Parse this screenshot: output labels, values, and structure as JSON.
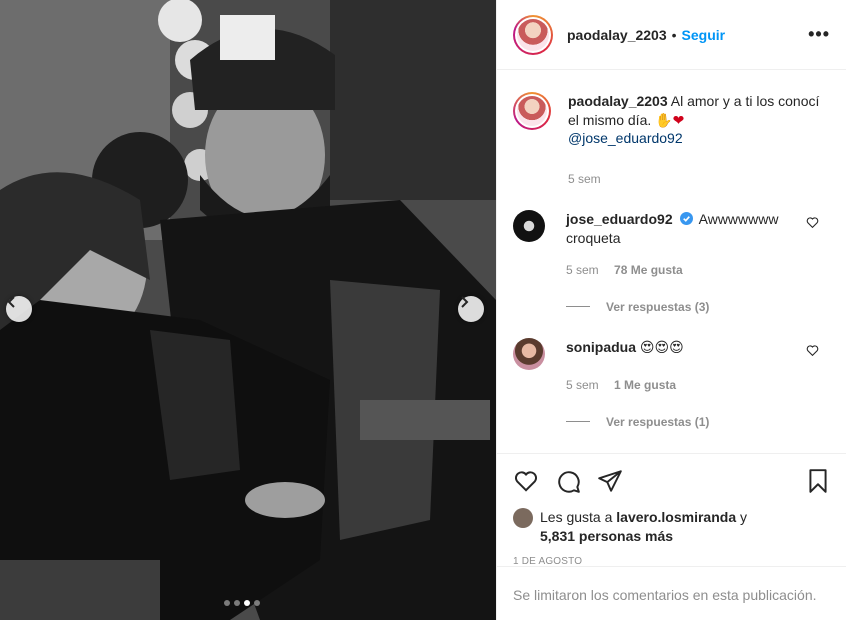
{
  "post": {
    "username": "paodalay_2203",
    "follow_label": "Seguir",
    "separator": "•",
    "more_label": "•••",
    "caption_text": "Al amor y a ti los conocí el mismo día. ✋",
    "caption_heart": "❤",
    "caption_mention": "@jose_eduardo92",
    "caption_time": "5 sem"
  },
  "comments": [
    {
      "username": "jose_eduardo92",
      "text": "Awwwwwww croqueta",
      "verified": true,
      "time": "5 sem",
      "likes": "78 Me gusta",
      "replies": "Ver respuestas (3)"
    },
    {
      "username": "sonipadua",
      "text": "😍😍😍",
      "time": "5 sem",
      "likes": "1 Me gusta",
      "replies": "Ver respuestas (1)"
    }
  ],
  "likes": {
    "prefix": "Les gusta a",
    "user": "lavero.losmiranda",
    "suffix": "y",
    "count": "5,831 personas más"
  },
  "date": "1 DE AGOSTO",
  "footer_note": "Se limitaron los comentarios en esta publicación.",
  "carousel": {
    "dot_count": 4,
    "active_index": 2
  },
  "colors": {
    "link": "#0095f6",
    "text": "#262626",
    "muted": "#8e8e8e",
    "mention": "#00376b"
  },
  "icons": [
    "chevron-left-icon",
    "chevron-right-icon",
    "heart-icon",
    "comment-icon",
    "share-icon",
    "bookmark-icon",
    "verified-icon"
  ]
}
